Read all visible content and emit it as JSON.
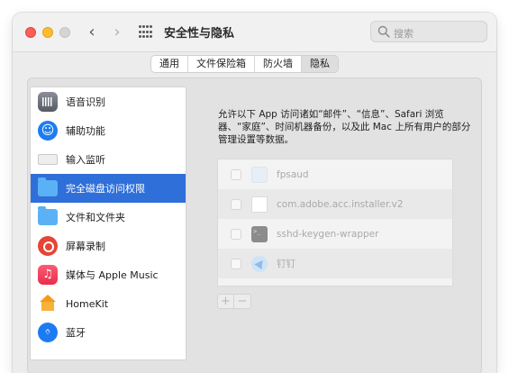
{
  "window": {
    "title": "安全性与隐私",
    "search_placeholder": "搜索"
  },
  "nav": {
    "back": "‹",
    "forward": "›"
  },
  "tabs": [
    {
      "label": "通用",
      "active": false
    },
    {
      "label": "文件保险箱",
      "active": false
    },
    {
      "label": "防火墙",
      "active": false
    },
    {
      "label": "隐私",
      "active": true
    }
  ],
  "sidebar": {
    "items": [
      {
        "label": "语音识别",
        "icon": "voice-recognition-icon"
      },
      {
        "label": "辅助功能",
        "icon": "accessibility-icon"
      },
      {
        "label": "输入监听",
        "icon": "keyboard-icon"
      },
      {
        "label": "完全磁盘访问权限",
        "icon": "folder-icon",
        "selected": true
      },
      {
        "label": "文件和文件夹",
        "icon": "folder-icon"
      },
      {
        "label": "屏幕录制",
        "icon": "screen-recording-icon"
      },
      {
        "label": "媒体与 Apple Music",
        "icon": "music-icon"
      },
      {
        "label": "HomeKit",
        "icon": "home-icon"
      },
      {
        "label": "蓝牙",
        "icon": "bluetooth-icon"
      }
    ]
  },
  "main": {
    "description": "允许以下 App 访问诸如“邮件”、“信息”、Safari 浏览器、“家庭”、时间机器备份，以及此 Mac 上所有用户的部分管理设置等数据。",
    "apps": [
      {
        "label": "fpsaud",
        "icon": "app-generic-icon"
      },
      {
        "label": "com.adobe.acc.installer.v2",
        "icon": "document-icon"
      },
      {
        "label": "sshd-keygen-wrapper",
        "icon": "terminal-icon"
      },
      {
        "label": "钉钉",
        "icon": "dingtalk-icon"
      }
    ],
    "add_label": "+",
    "remove_label": "−"
  },
  "colors": {
    "selection": "#2f6fd9",
    "close": "#fe5f57",
    "minimize": "#febc2e"
  }
}
